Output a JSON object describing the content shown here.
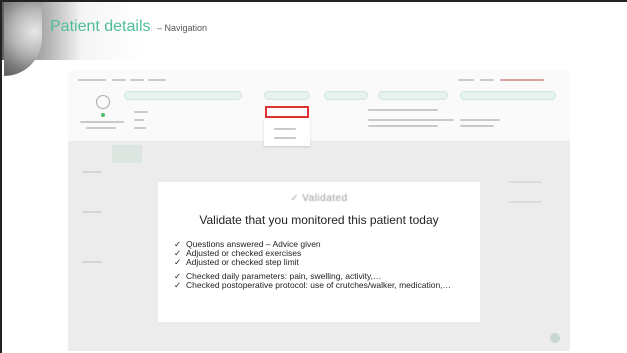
{
  "slide": {
    "title": "Patient details",
    "subtitle": "– Navigation"
  },
  "colors": {
    "title_accent": "#4fbf9a",
    "highlight_box": "#e03030",
    "status_dot": "#4fbf6a"
  },
  "dialog": {
    "heading": "Validated",
    "heading_icon": "check-icon",
    "question": "Validate that you monitored this patient today",
    "items": [
      "Questions answered – Advice given",
      "Adjusted or checked exercises",
      "Adjusted or checked step limit",
      "Checked daily parameters: pain, swelling, activity,…",
      "Checked postoperative protocol: use of crutches/walker, medication,…"
    ],
    "tick": "✓"
  }
}
